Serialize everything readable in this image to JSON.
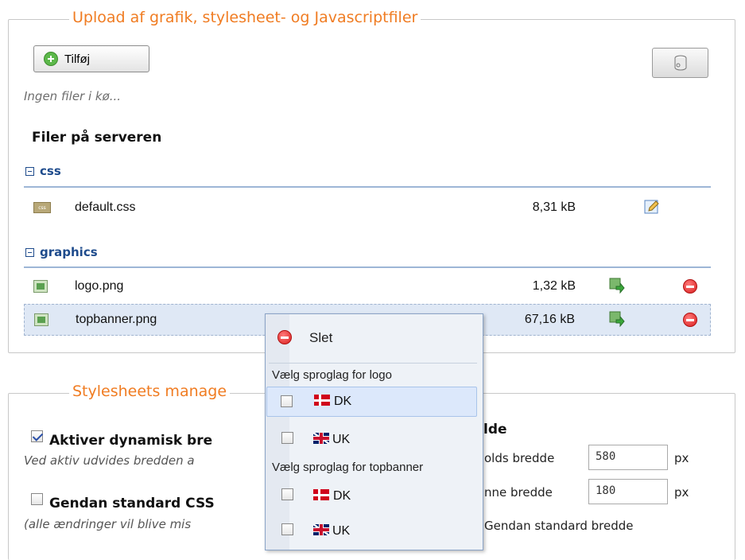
{
  "upload": {
    "legend": "Upload af grafik, stylesheet- og Javascriptfiler",
    "add_button_label": "Tilføj",
    "queue_status": "Ingen filer i kø...",
    "files_heading": "Filer på serveren",
    "groups": [
      {
        "name": "css",
        "files": [
          {
            "name": "default.css",
            "size": "8,31 kB",
            "icon": "css-file-icon",
            "action_icon": "edit-pencil-icon"
          }
        ]
      },
      {
        "name": "graphics",
        "files": [
          {
            "name": "logo.png",
            "size": "1,32 kB",
            "icon": "image-file-icon",
            "action_icon": "insert-image-arrow-icon",
            "delete_icon": "delete-icon"
          },
          {
            "name": "topbanner.png",
            "size": "67,16 kB",
            "icon": "image-file-icon",
            "action_icon": "insert-image-arrow-icon",
            "delete_icon": "delete-icon",
            "selected": true
          }
        ]
      }
    ]
  },
  "stylesheets": {
    "legend": "Stylesheets manage",
    "dynamic_width": {
      "title": "Aktiver dynamisk bre",
      "description": "Ved aktiv udvides bredden a",
      "checked": true
    },
    "restore_css": {
      "title": "Gendan standard CSS",
      "description": "(alle ændringer vil blive mis",
      "checked": false
    },
    "right_heading_suffix": "lde",
    "content_width": {
      "label": "olds bredde",
      "value": "580",
      "unit": "px"
    },
    "column_width": {
      "label": "nne bredde",
      "value": "180",
      "unit": "px"
    },
    "restore_width_label": "Gendan standard bredde"
  },
  "context_menu": {
    "delete_label": "Slet",
    "sections": [
      {
        "heading": "Vælg sproglag for logo",
        "options": [
          {
            "flag": "dk-flag-icon",
            "label": "DK",
            "checked": false,
            "highlighted": true
          },
          {
            "flag": "uk-flag-icon",
            "label": "UK",
            "checked": false
          }
        ]
      },
      {
        "heading": "Vælg sproglag for topbanner",
        "options": [
          {
            "flag": "dk-flag-icon",
            "label": "DK",
            "checked": false
          },
          {
            "flag": "uk-flag-icon",
            "label": "UK",
            "checked": false
          }
        ]
      }
    ]
  },
  "colors": {
    "legend_orange": "#f07c22",
    "group_blue": "#1e4b8c",
    "selected_row": "#dfe8f5",
    "delete_red": "#d91f1f"
  }
}
